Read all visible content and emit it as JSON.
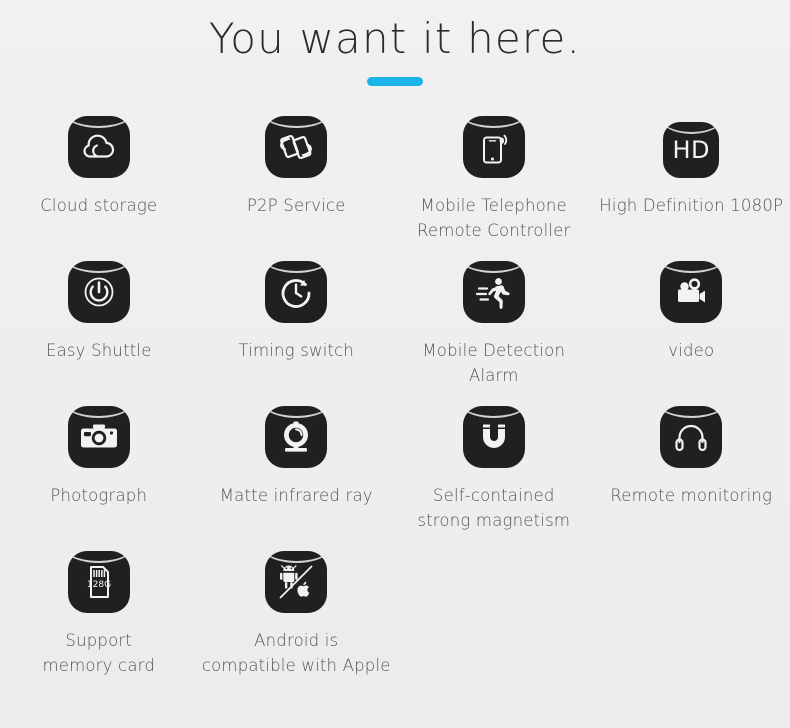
{
  "header": {
    "title": "You want it here.",
    "accent_color": "#1ab4e8"
  },
  "theme": {
    "background": "#f0f0f0",
    "tile_background": "#211f1f",
    "label_color": "#555555",
    "title_color": "#2b2b2b"
  },
  "features": {
    "rows": [
      [
        {
          "icon": "cloud-icon",
          "label": "Cloud storage"
        },
        {
          "icon": "p2p-sync-phones-icon",
          "label": "P2P Service"
        },
        {
          "icon": "mobile-phone-signal-icon",
          "label": "Mobile Telephone\nRemote Controller"
        },
        {
          "icon": "hd-badge-icon",
          "label": "High Definition 1080P",
          "icon_text": "HD"
        }
      ],
      [
        {
          "icon": "power-button-icon",
          "label": "Easy Shuttle"
        },
        {
          "icon": "clock-timer-icon",
          "label": "Timing switch"
        },
        {
          "icon": "running-person-icon",
          "label": "Mobile Detection Alarm"
        },
        {
          "icon": "video-camera-icon",
          "label": "video"
        }
      ],
      [
        {
          "icon": "photo-camera-icon",
          "label": "Photograph"
        },
        {
          "icon": "webcam-icon",
          "label": "Matte infrared ray"
        },
        {
          "icon": "magnet-icon",
          "label": "Self-contained\nstrong magnetism"
        },
        {
          "icon": "headphones-icon",
          "label": "Remote monitoring"
        }
      ],
      [
        {
          "icon": "memory-card-icon",
          "label": "Support\nmemory card",
          "icon_text": "128G"
        },
        {
          "icon": "android-apple-icon",
          "label": "Android is\ncompatible  with Apple"
        }
      ]
    ]
  }
}
